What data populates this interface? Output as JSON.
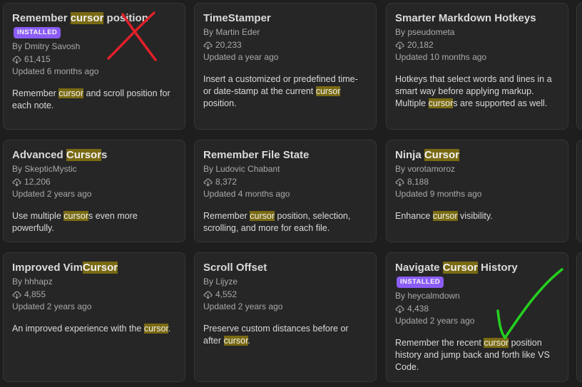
{
  "plugins": [
    {
      "title_segments": [
        {
          "text": "Remember ",
          "hl": false
        },
        {
          "text": "cursor",
          "hl": true
        },
        {
          "text": " position",
          "hl": false
        }
      ],
      "installed": true,
      "author": "By Dmitry Savosh",
      "downloads": "61,415",
      "updated": "Updated 6 months ago",
      "desc_segments": [
        {
          "text": "Remember ",
          "hl": false
        },
        {
          "text": "cursor",
          "hl": true
        },
        {
          "text": " and scroll position for each note.",
          "hl": false
        }
      ]
    },
    {
      "title_segments": [
        {
          "text": "TimeStamper",
          "hl": false
        }
      ],
      "installed": false,
      "author": "By Martin Eder",
      "downloads": "20,233",
      "updated": "Updated a year ago",
      "desc_segments": [
        {
          "text": "Insert a customized or predefined time- or date-stamp at the current ",
          "hl": false
        },
        {
          "text": "cursor",
          "hl": true
        },
        {
          "text": " position.",
          "hl": false
        }
      ]
    },
    {
      "title_segments": [
        {
          "text": "Smarter Markdown Hotkeys",
          "hl": false
        }
      ],
      "installed": false,
      "author": "By pseudometa",
      "downloads": "20,182",
      "updated": "Updated 10 months ago",
      "desc_segments": [
        {
          "text": "Hotkeys that select words and lines in a smart way before applying markup. Multiple ",
          "hl": false
        },
        {
          "text": "cursor",
          "hl": true
        },
        {
          "text": "s are supported as well.",
          "hl": false
        }
      ]
    },
    {
      "title_segments": [
        {
          "text": "Advanced ",
          "hl": false
        },
        {
          "text": "Cursor",
          "hl": true
        },
        {
          "text": "s",
          "hl": false
        }
      ],
      "installed": false,
      "author": "By SkepticMystic",
      "downloads": "12,206",
      "updated": "Updated 2 years ago",
      "desc_segments": [
        {
          "text": "Use multiple ",
          "hl": false
        },
        {
          "text": "cursor",
          "hl": true
        },
        {
          "text": "s even more powerfully.",
          "hl": false
        }
      ]
    },
    {
      "title_segments": [
        {
          "text": "Remember File State",
          "hl": false
        }
      ],
      "installed": false,
      "author": "By Ludovic Chabant",
      "downloads": "8,372",
      "updated": "Updated 4 months ago",
      "desc_segments": [
        {
          "text": "Remember ",
          "hl": false
        },
        {
          "text": "cursor",
          "hl": true
        },
        {
          "text": " position, selection, scrolling, and more for each file.",
          "hl": false
        }
      ]
    },
    {
      "title_segments": [
        {
          "text": "Ninja ",
          "hl": false
        },
        {
          "text": "Cursor",
          "hl": true
        }
      ],
      "installed": false,
      "author": "By vorotamoroz",
      "downloads": "8,188",
      "updated": "Updated 9 months ago",
      "desc_segments": [
        {
          "text": "Enhance ",
          "hl": false
        },
        {
          "text": "cursor",
          "hl": true
        },
        {
          "text": " visibility.",
          "hl": false
        }
      ]
    },
    {
      "title_segments": [
        {
          "text": "Improved Vim",
          "hl": false
        },
        {
          "text": "Cursor",
          "hl": true
        }
      ],
      "installed": false,
      "author": "By hhhapz",
      "downloads": "4,855",
      "updated": "Updated 2 years ago",
      "desc_segments": [
        {
          "text": "An improved experience with the ",
          "hl": false
        },
        {
          "text": "cursor",
          "hl": true
        },
        {
          "text": ".",
          "hl": false
        }
      ]
    },
    {
      "title_segments": [
        {
          "text": "Scroll Offset",
          "hl": false
        }
      ],
      "installed": false,
      "author": "By Lijyze",
      "downloads": "4,552",
      "updated": "Updated 2 years ago",
      "desc_segments": [
        {
          "text": "Preserve custom distances before or after ",
          "hl": false
        },
        {
          "text": "cursor",
          "hl": true
        },
        {
          "text": ".",
          "hl": false
        }
      ]
    },
    {
      "title_segments": [
        {
          "text": "Navigate ",
          "hl": false
        },
        {
          "text": "Cursor",
          "hl": true
        },
        {
          "text": " History",
          "hl": false
        }
      ],
      "installed": true,
      "author": "By heycalmdown",
      "downloads": "4,438",
      "updated": "Updated 2 years ago",
      "desc_segments": [
        {
          "text": "Remember the recent ",
          "hl": false
        },
        {
          "text": "cursor",
          "hl": true
        },
        {
          "text": " position history and jump back and forth like VS Code.",
          "hl": false
        }
      ]
    }
  ],
  "labels": {
    "installed_badge": "INSTALLED"
  },
  "icons": {
    "downloads": "download-icon"
  },
  "colors": {
    "highlight": "#7a6a12",
    "badge": "#8b5cf6",
    "cross_mark": "#e0202a",
    "check_mark": "#25d01e"
  }
}
